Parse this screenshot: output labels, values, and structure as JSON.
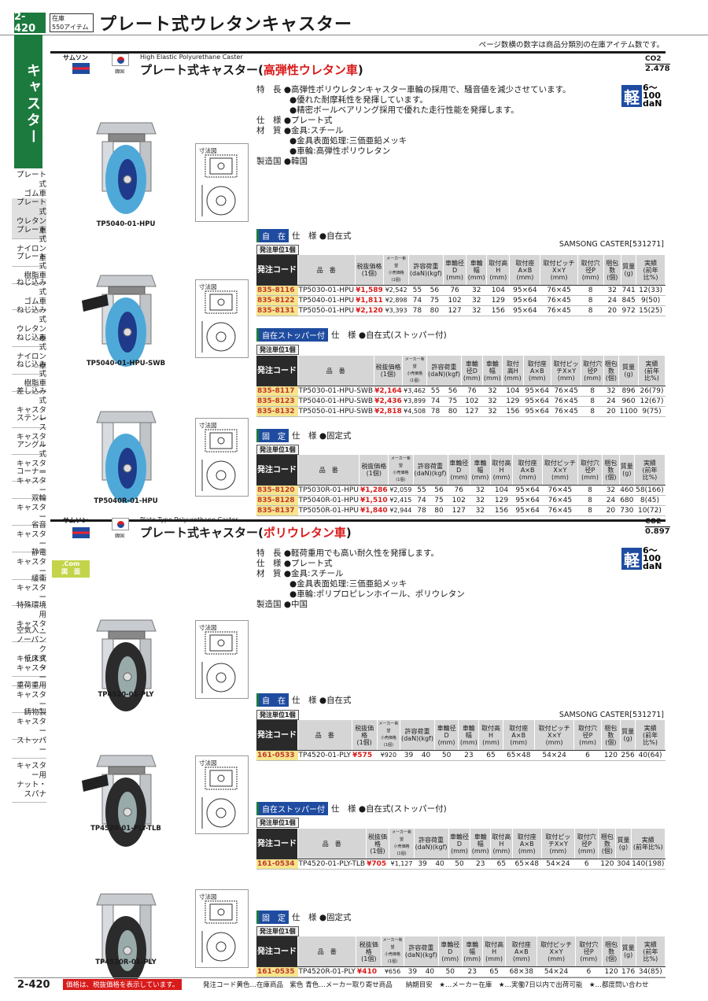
{
  "header": {
    "page": "2-420",
    "stock_label": "在庫",
    "stock_count": "550アイテム",
    "title": "プレート式ウレタンキャスター",
    "note": "ページ数横の数字は商品分類別の在庫アイテム数です。"
  },
  "sidebar": {
    "title": "キャスター",
    "items": [
      "プレート式\nゴム車",
      "プレート式\nウレタン車",
      "プレート式\nナイロン車",
      "プレート式\n樹脂車",
      "ねじ込み式\nゴム車",
      "ねじ込み式\nウレタン車",
      "ねじ込み式\nナイロン車",
      "ねじ込み式\n樹脂車",
      "差し込み式\nキャスター",
      "ステンレス\nキャスター",
      "アングル式\nキャスター",
      "コーナー\nキャスター",
      "双輪\nキャスター",
      "省音\nキャスター",
      "静電\nキャスター",
      "緩衝\nキャスター",
      "特殊環境用\nキャスター",
      "空気入・\nノーパンク\nキャスター",
      "低床式\nキャスター",
      "重荷重用\nキャスター",
      "鋳物製\nキャスター",
      "ストッパー",
      "キャスター用\nナット・スパナ"
    ]
  },
  "colors": {
    "green": "#1d7a3e",
    "red": "#d81b1b",
    "blue": "#1f4ca0",
    "yellow": "#f6e58d"
  },
  "sec1": {
    "brand": "サムソン",
    "country": "韓国",
    "en_title": "High Elastic Polyurethane Caster",
    "title_a": "プレート式キャスター(",
    "title_b": "高弾性ウレタン車",
    "title_c": ")",
    "co2_label": "CO2",
    "co2_value": "2.478",
    "light": "軽",
    "light_range": "6〜100",
    "light_unit": "daN",
    "features": "特　長 ●高弾性ポリウレタンキャスター車輪の採用で、騒音値を減少させています。\n　　　　●優れた耐摩耗性を発揮しています。\n　　　　●精密ボールベアリング採用で優れた走行性能を発揮します。\n仕　様 ●プレート式\n材　質 ●金具:スチール\n　　　　●金具表面処理:三価亜鉛メッキ\n　　　　●車輪:高弾性ポリウレタン\n製造国 ●韓国",
    "samsong": "SAMSONG CASTER[531271]",
    "groups": [
      {
        "img": "TP5040-01-HPU",
        "tag": "自　在",
        "spec": "仕　様 ●自在式",
        "rows": [
          [
            "835-8116",
            "TP5030-01-HPU",
            "¥1,589",
            "¥2,542",
            "55",
            "56",
            "76",
            "32",
            "104",
            "95×64",
            "76×45",
            "8",
            "32",
            "741",
            "12(33)"
          ],
          [
            "835-8122",
            "TP5040-01-HPU",
            "¥1,811",
            "¥2,898",
            "74",
            "75",
            "102",
            "32",
            "129",
            "95×64",
            "76×45",
            "8",
            "24",
            "845",
            "9(50)"
          ],
          [
            "835-8131",
            "TP5050-01-HPU",
            "¥2,120",
            "¥3,393",
            "78",
            "80",
            "127",
            "32",
            "156",
            "95×64",
            "76×45",
            "8",
            "20",
            "972",
            "15(25)"
          ]
        ]
      },
      {
        "img": "TP5040-01-HPU-SWB",
        "tag": "自在ストッパー付",
        "spec": "仕　様 ●自在式(ストッパー付)",
        "rows": [
          [
            "835-8117",
            "TP5030-01-HPU-SWB",
            "¥2,164",
            "¥3,462",
            "55",
            "56",
            "76",
            "32",
            "104",
            "95×64",
            "76×45",
            "8",
            "32",
            "896",
            "26(79)"
          ],
          [
            "835-8123",
            "TP5040-01-HPU-SWB",
            "¥2,436",
            "¥3,899",
            "74",
            "75",
            "102",
            "32",
            "129",
            "95×64",
            "76×45",
            "8",
            "24",
            "960",
            "12(67)"
          ],
          [
            "835-8132",
            "TP5050-01-HPU-SWB",
            "¥2,818",
            "¥4,508",
            "78",
            "80",
            "127",
            "32",
            "156",
            "95×64",
            "76×45",
            "8",
            "20",
            "1100",
            "9(75)"
          ]
        ]
      },
      {
        "img": "TP5040R-01-HPU",
        "tag": "固　定",
        "spec": "仕　様 ●固定式",
        "rows": [
          [
            "835-8120",
            "TP5030R-01-HPU",
            "¥1,286",
            "¥2,059",
            "55",
            "56",
            "76",
            "32",
            "104",
            "95×64",
            "76×45",
            "8",
            "32",
            "460",
            "58(166)"
          ],
          [
            "835-8128",
            "TP5040R-01-HPU",
            "¥1,510",
            "¥2,415",
            "74",
            "75",
            "102",
            "32",
            "129",
            "95×64",
            "76×45",
            "8",
            "24",
            "680",
            "8(45)"
          ],
          [
            "835-8137",
            "TP5050R-01-HPU",
            "¥1,840",
            "¥2,944",
            "78",
            "80",
            "127",
            "32",
            "156",
            "95×64",
            "76×45",
            "8",
            "20",
            "730",
            "10(72)"
          ]
        ]
      }
    ]
  },
  "sec2": {
    "brand": "サムソン",
    "country": "韓国",
    "en_title": "Plate Type Polyurethane Caster",
    "title_a": "プレート式キャスター(",
    "title_b": "ポリウレタン車",
    "title_c": ")",
    "co2_label": "CO2",
    "co2_value": "0.897",
    "light": "軽",
    "light_range": "6〜100",
    "light_unit": "daN",
    "dotcom": ".Com",
    "dotcom_sub": "図　面",
    "features": "特　長 ●軽荷重用でも高い耐久性を発揮します。\n仕　様 ●プレート式\n材　質 ●金具:スチール\n　　　　●金具表面処理:三価亜鉛メッキ\n　　　　●車輪:ポリプロピレンホイール、ポリウレタン\n製造国 ●中国",
    "samsong": "SAMSONG CASTER[531271]",
    "groups": [
      {
        "img": "TP4520-01-PLY",
        "tag": "自　在",
        "spec": "仕　様 ●自在式",
        "rows": [
          [
            "161-0533",
            "TP4520-01-PLY",
            "¥575",
            "¥920",
            "39",
            "40",
            "50",
            "23",
            "65",
            "65×48",
            "54×24",
            "6",
            "120",
            "256",
            "40(64)"
          ]
        ]
      },
      {
        "img": "TP4520-01-PLY-TLB",
        "tag": "自在ストッパー付",
        "spec": "仕　様 ●自在式(ストッパー付)",
        "rows": [
          [
            "161-0534",
            "TP4520-01-PLY-TLB",
            "¥705",
            "¥1,127",
            "39",
            "40",
            "50",
            "23",
            "65",
            "65×48",
            "54×24",
            "6",
            "120",
            "304",
            "140(198)"
          ]
        ]
      },
      {
        "img": "TP4520R-01-PLY",
        "tag": "固　定",
        "spec": "仕　様 ●固定式",
        "rows": [
          [
            "161-0535",
            "TP4520R-01-PLY",
            "¥410",
            "¥656",
            "39",
            "40",
            "50",
            "23",
            "65",
            "68×38",
            "54×24",
            "6",
            "120",
            "176",
            "34(85)"
          ]
        ]
      }
    ]
  },
  "table_headers": {
    "unit": "発注単位1個",
    "code": "発注コード",
    "name": "品　番",
    "price": "税抜価格\n(1個)",
    "maker": "メーカー希望\n小売価格\n(1個)",
    "load": "許容荷重",
    "load_dan": "(daN)",
    "load_kgf": "(kgf)",
    "wd": "車輪径D\n(mm)",
    "ww": "車輪幅\n(mm)",
    "h": "取付高H\n(mm)",
    "ab": "取付座A×B\n(mm)",
    "xy": "取付ピッチX×Y\n(mm)",
    "p": "取付穴径P\n(mm)",
    "qty": "梱包数\n(個)",
    "mass": "質量\n(g)",
    "perf": "実績\n(前年比%)"
  },
  "dim_label": "寸法図",
  "footer": {
    "page": "2-420",
    "note": "価格は、税抜価格を表示しています。",
    "legend": "発注コード黄色…在庫商品　紫色 青色…メーカー取り寄せ商品　　納期目安　★…メーカー在庫　★…実働7日以内で出荷可能　★…都度問い合わせ"
  }
}
